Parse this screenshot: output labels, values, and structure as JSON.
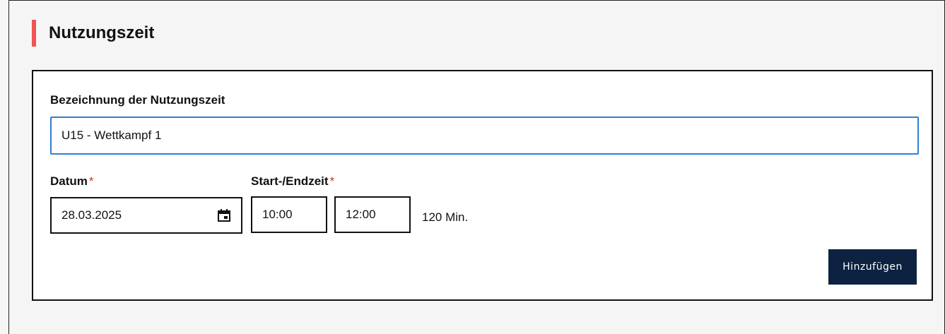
{
  "section": {
    "title": "Nutzungszeit",
    "accent_color": "#f05454"
  },
  "form": {
    "name_label": "Bezeichnung der Nutzungszeit",
    "name_value": "U15 - Wettkampf 1",
    "date_label": "Datum",
    "date_value": "28.03.2025",
    "date_icon": "calendar-icon",
    "time_label": "Start-/Endzeit",
    "required_marker": "*",
    "start_time": "10:00",
    "end_time": "12:00",
    "duration_text": "120 Min.",
    "add_button_label": "Hinzufügen",
    "add_button_color": "#0d2240",
    "focus_color": "#2f7fd6"
  }
}
